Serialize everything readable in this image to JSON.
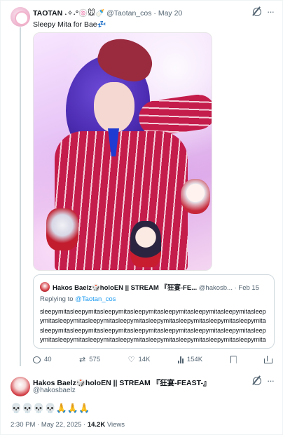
{
  "tweet": {
    "author_name": "TAOTAN ˖✧˖°🍥🐭🍼",
    "handle": "@Taotan_cos",
    "separator": "·",
    "date": "May 20",
    "text": "Sleepy Mita for Bae💤"
  },
  "quote": {
    "author_name": "Hakos Baelz🎲holoEN || STREAM 『狂宴-FE...",
    "handle": "@hakosb...",
    "separator": "·",
    "date": "Feb 15",
    "replying_prefix": "Replying to ",
    "replying_handle": "@Taotan_cos",
    "body": "sleepymitasleepymitasleepymitasleepymitasleepymitasleepymitasleepymitasleepymitasleepymitasleepymitasleepymitasleepymitasleepymitasleepymitasleepymitasleepymitasleepymitasleepymitasleepymitasleepymitasleepymitasleepymitasleepymitasleepymitasleepymitasleepymitasleepymitasleepymitasleepymitasleepymitasleepymitasleepymitasleepy..."
  },
  "actions": {
    "replies": "40",
    "reposts": "575",
    "likes": "14K",
    "views": "154K"
  },
  "reply": {
    "author_name": "Hakos Baelz🎲holoEN || STREAM 『狂宴-FEAST-』",
    "handle": "@hakosbaelz",
    "text": "💀💀💀💀🙏🙏🙏",
    "time": "2:30 PM · May 22, 2025 ·",
    "views": "14.2K",
    "views_label": "Views"
  },
  "icons": {
    "menu": "more-icon",
    "grok": "grok-icon"
  },
  "colors": {
    "text": "#0f1419",
    "muted": "#536471",
    "link": "#1d9bf0",
    "border": "#cfd9de"
  }
}
